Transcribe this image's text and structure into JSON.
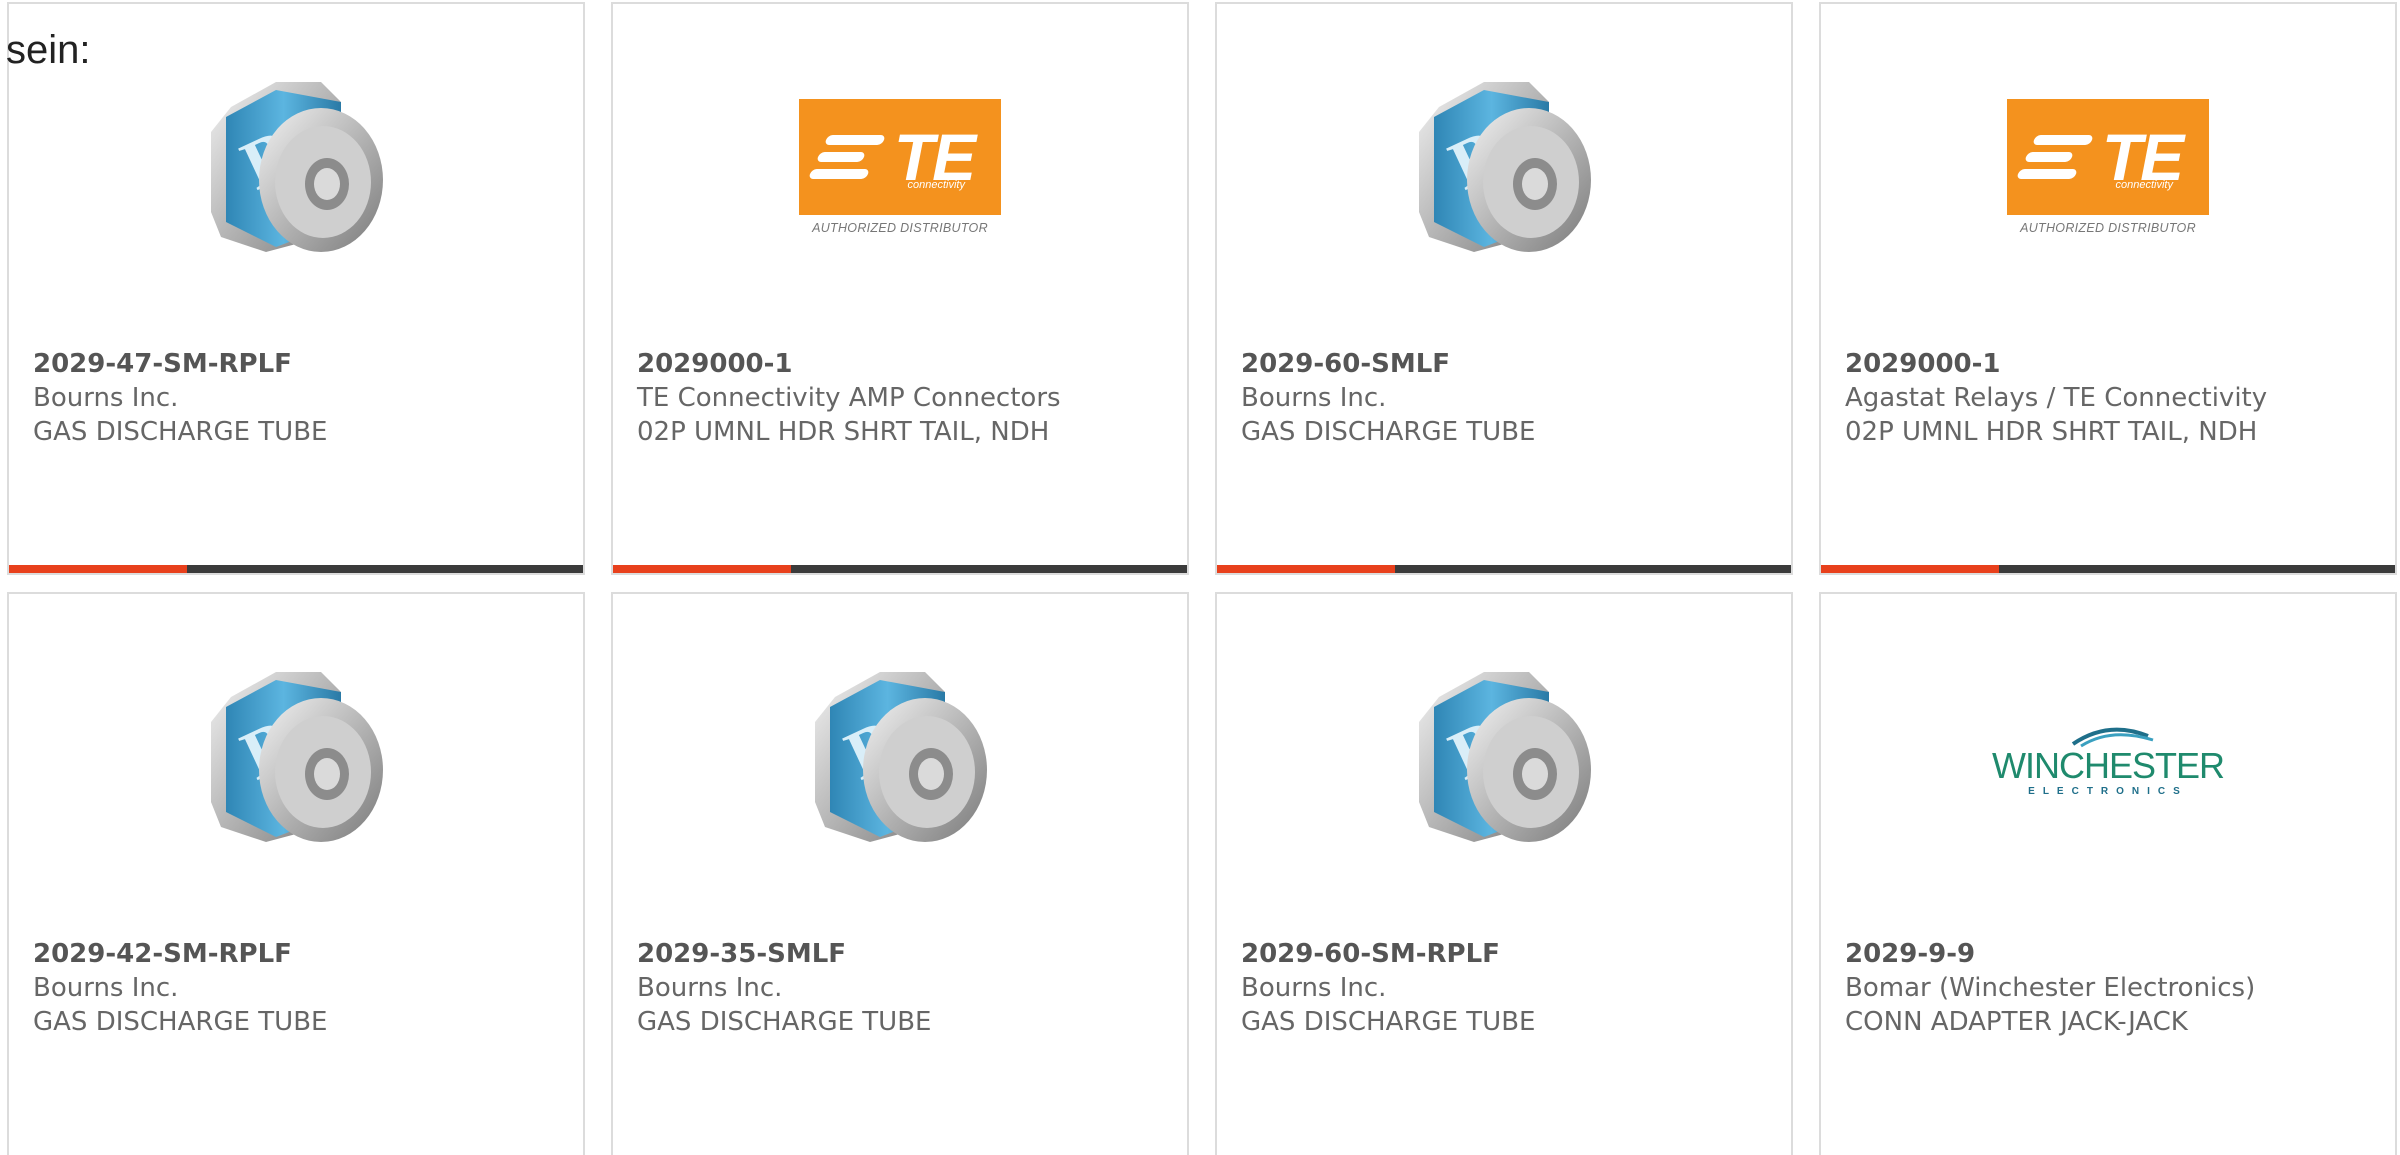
{
  "intro_text": "sein:",
  "colors": {
    "accent": "#e8401c",
    "bar_dark": "#3b3b3b",
    "te_orange": "#f4921e",
    "bourns_blue": "#3b9cc9",
    "winchester_green": "#1f8a6d"
  },
  "cards": [
    {
      "part_number": "2029-47-SM-RPLF",
      "manufacturer": "Bourns Inc.",
      "description": "GAS DISCHARGE TUBE",
      "image": "gas-discharge-tube-icon",
      "progress": 0.31
    },
    {
      "part_number": "2029000-1",
      "manufacturer": "TE Connectivity AMP Connectors",
      "description": "02P UMNL HDR SHRT TAIL, NDH",
      "image": "te-connectivity-logo",
      "logo_text": "TE",
      "logo_sub": "connectivity",
      "logo_caption": "AUTHORIZED DISTRIBUTOR",
      "progress": 0.31
    },
    {
      "part_number": "2029-60-SMLF",
      "manufacturer": "Bourns Inc.",
      "description": "GAS DISCHARGE TUBE",
      "image": "gas-discharge-tube-icon",
      "progress": 0.31
    },
    {
      "part_number": "2029000-1",
      "manufacturer": "Agastat Relays / TE Connectivity",
      "description": "02P UMNL HDR SHRT TAIL, NDH",
      "image": "te-connectivity-logo",
      "logo_text": "TE",
      "logo_sub": "connectivity",
      "logo_caption": "AUTHORIZED DISTRIBUTOR",
      "progress": 0.31
    },
    {
      "part_number": "2029-42-SM-RPLF",
      "manufacturer": "Bourns Inc.",
      "description": "GAS DISCHARGE TUBE",
      "image": "gas-discharge-tube-icon"
    },
    {
      "part_number": "2029-35-SMLF",
      "manufacturer": "Bourns Inc.",
      "description": "GAS DISCHARGE TUBE",
      "image": "gas-discharge-tube-icon"
    },
    {
      "part_number": "2029-60-SM-RPLF",
      "manufacturer": "Bourns Inc.",
      "description": "GAS DISCHARGE TUBE",
      "image": "gas-discharge-tube-icon"
    },
    {
      "part_number": "2029-9-9",
      "manufacturer": "Bomar (Winchester Electronics)",
      "description": "CONN ADAPTER JACK-JACK",
      "image": "winchester-electronics-logo",
      "logo_text": "WINCHESTER",
      "logo_sub": "ELECTRONICS"
    }
  ]
}
